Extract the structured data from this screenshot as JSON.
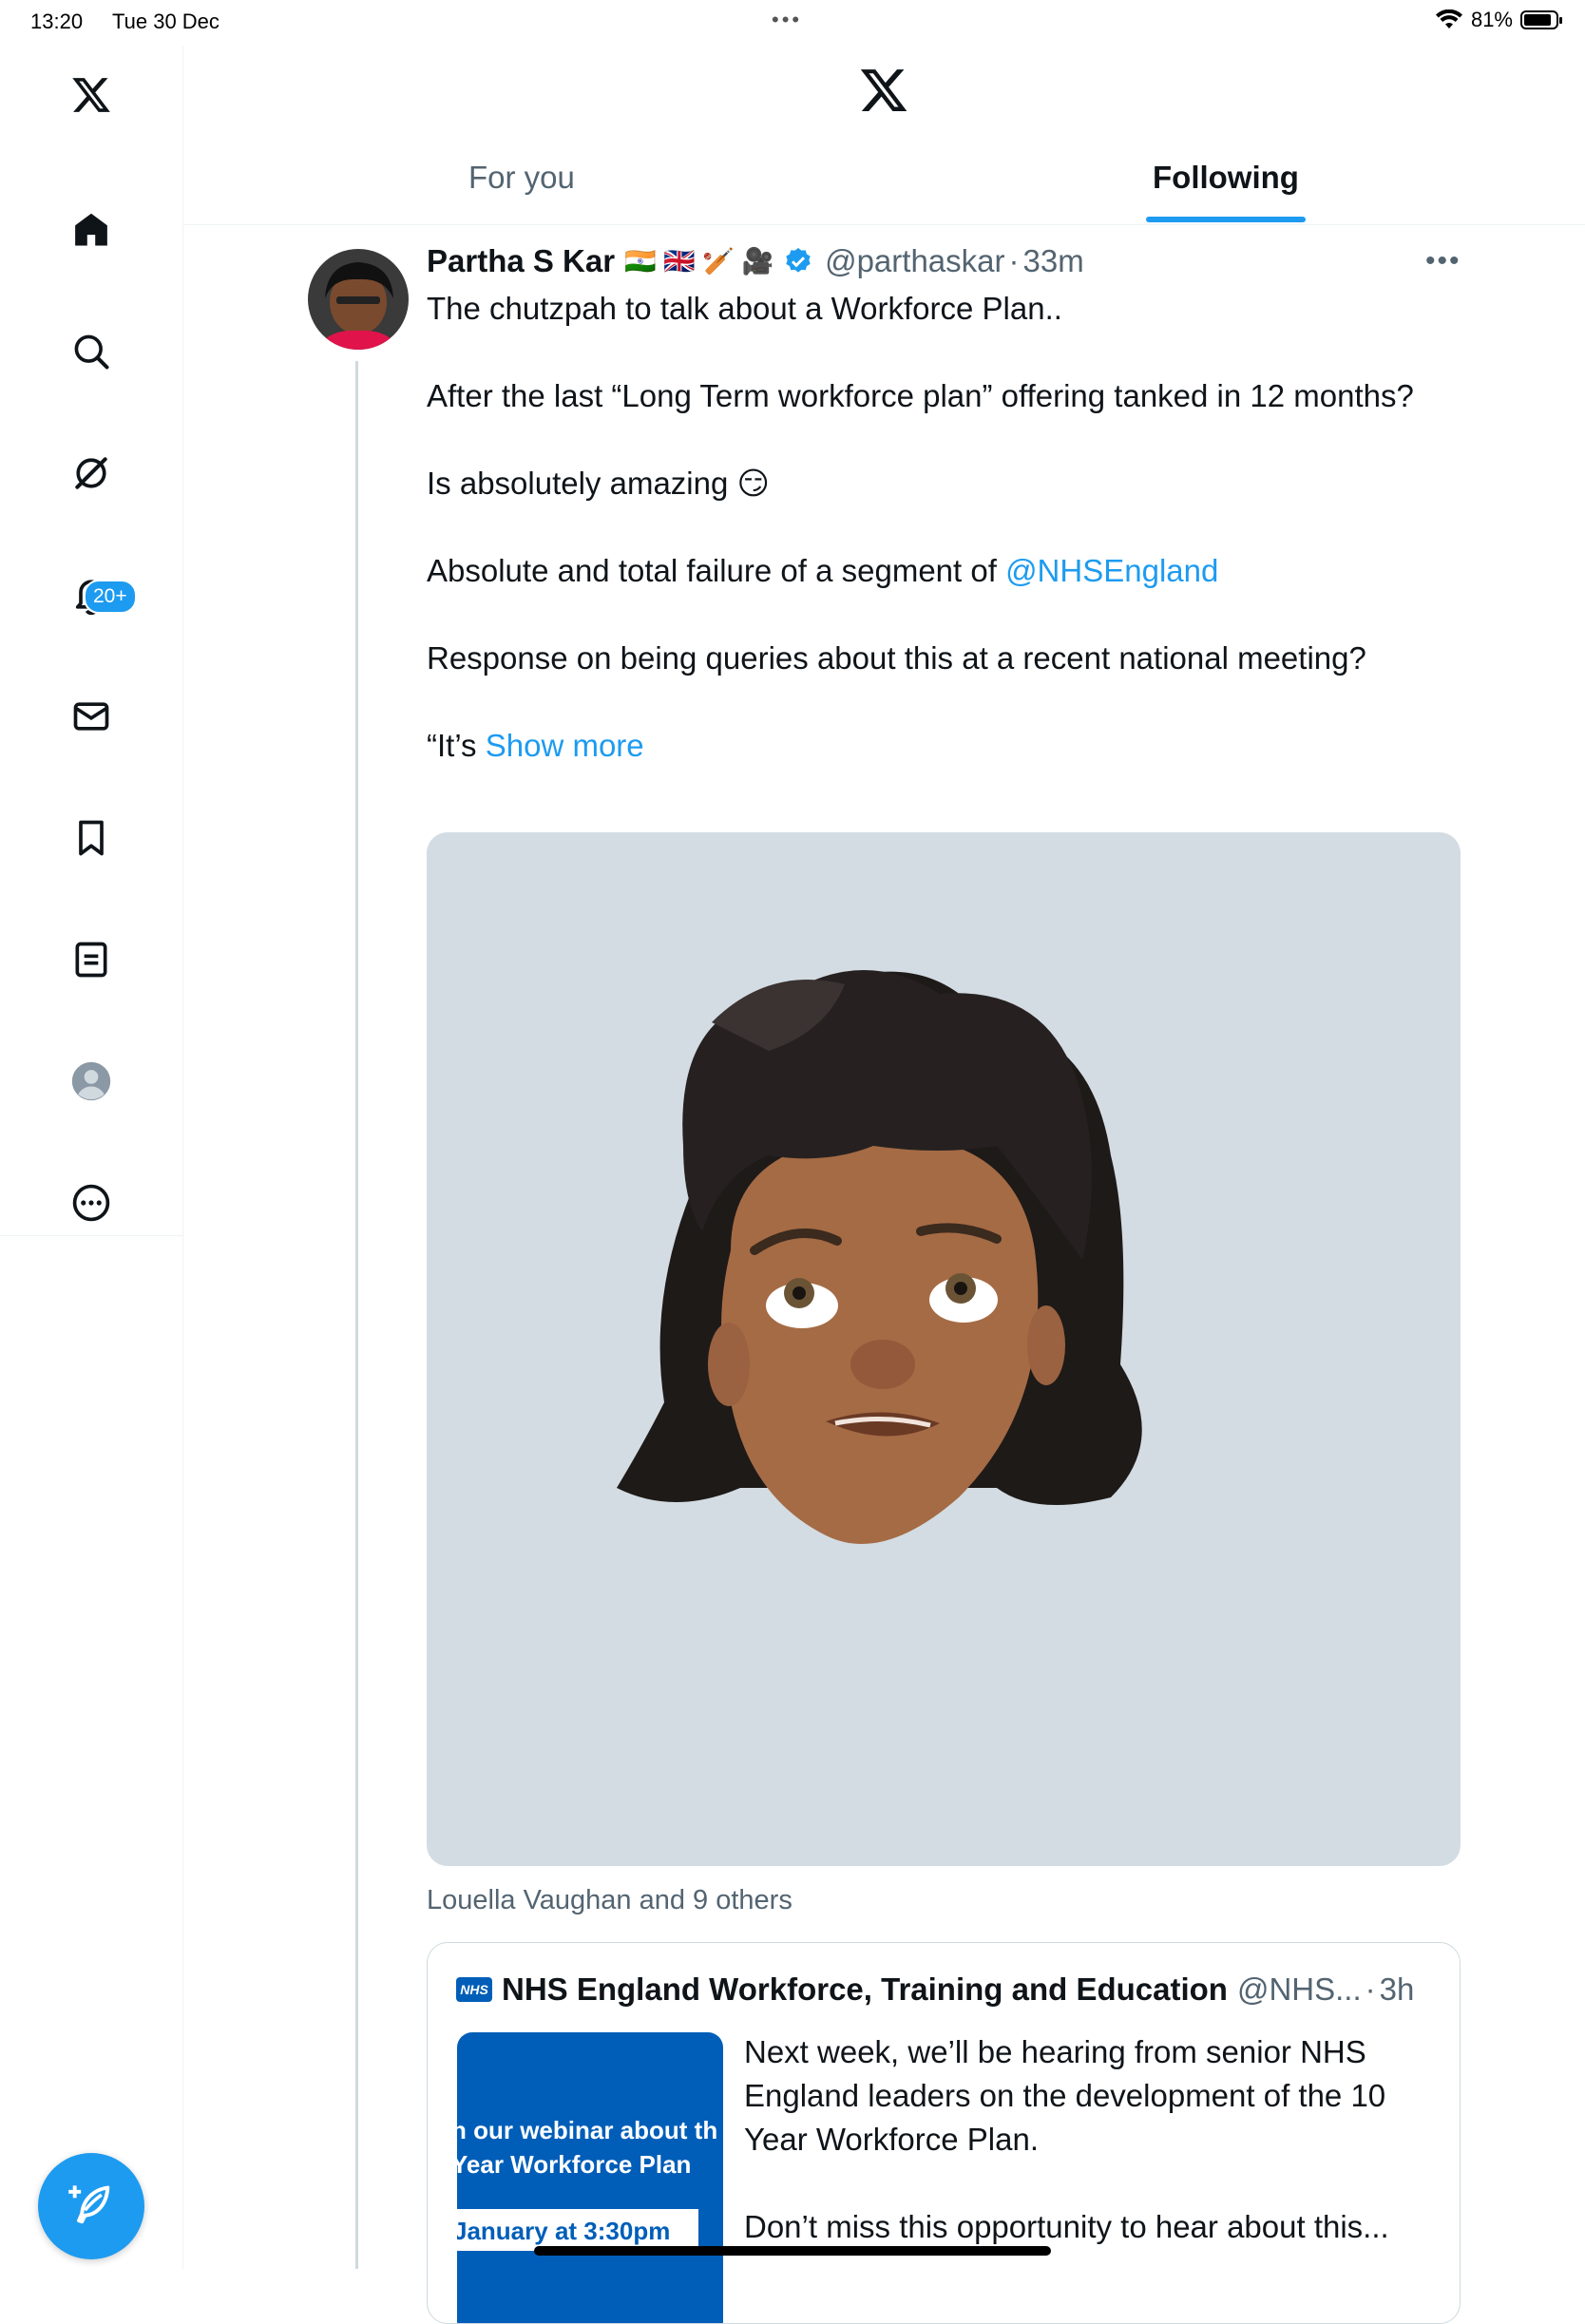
{
  "status_bar": {
    "time": "13:20",
    "date": "Tue 30 Dec",
    "battery": "81%"
  },
  "colors": {
    "accent": "#1d9bf0",
    "nhs_blue": "#005eb8",
    "text_primary": "#0f1419",
    "text_secondary": "#536471"
  },
  "sidebar": {
    "items": [
      {
        "icon": "x-logo-icon"
      },
      {
        "icon": "home-icon"
      },
      {
        "icon": "search-icon"
      },
      {
        "icon": "grok-icon"
      },
      {
        "icon": "notifications-icon",
        "badge": "20+"
      },
      {
        "icon": "messages-icon"
      },
      {
        "icon": "bookmarks-icon"
      },
      {
        "icon": "lists-icon"
      },
      {
        "icon": "profile-icon"
      },
      {
        "icon": "more-icon"
      }
    ],
    "compose_icon": "compose-icon"
  },
  "header": {
    "tabs": [
      {
        "label": "For you",
        "active": false
      },
      {
        "label": "Following",
        "active": true
      }
    ]
  },
  "tweet": {
    "name": "Partha S Kar",
    "name_emojis": "🇮🇳 🇬🇧 🏏 🎥",
    "verified": true,
    "handle": "@parthaskar",
    "separator": "·",
    "time": "33m",
    "text": {
      "p1": "The chutzpah to talk about a Workforce Plan..",
      "p2": "After the last “Long Term workforce plan” offering tanked in 12 months?",
      "p3": "Is absolutely amazing 😏",
      "p4_prefix": "Absolute and total failure of a segment of ",
      "p4_mention": "@NHSEngland",
      "p5": "Response on being queries about this at a recent national meeting?",
      "p6_prefix": "“It’s ",
      "show_more": "Show more"
    },
    "liked_by": "Louella Vaughan and 9 others"
  },
  "quoted_tweet": {
    "icon_text": "NHS",
    "name": "NHS England Workforce, Training and Education",
    "handle": "@NHS...",
    "separator": "·",
    "time": "3h",
    "image_lines": [
      "n our webinar about th",
      "Year Workforce Plan",
      "January at 3:30pm"
    ],
    "text_p1": "Next week, we’ll be hearing from senior NHS England leaders on the development of the 10 Year Workforce Plan.",
    "text_p2": "Don’t miss this opportunity to hear about this..."
  }
}
